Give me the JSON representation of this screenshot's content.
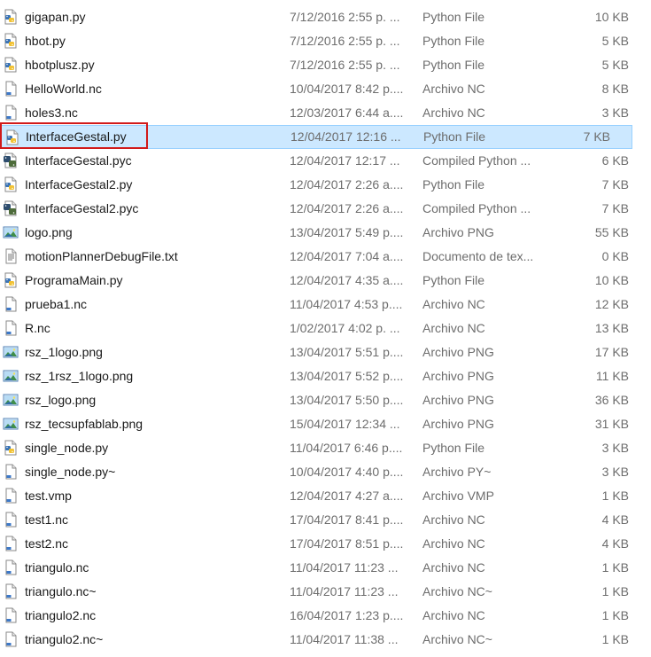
{
  "files": [
    {
      "name": "gigapan.py",
      "date": "7/12/2016 2:55 p. ...",
      "type": "Python File",
      "size": "10 KB",
      "icon": "python-file-icon"
    },
    {
      "name": "hbot.py",
      "date": "7/12/2016 2:55 p. ...",
      "type": "Python File",
      "size": "5 KB",
      "icon": "python-file-icon"
    },
    {
      "name": "hbotplusz.py",
      "date": "7/12/2016 2:55 p. ...",
      "type": "Python File",
      "size": "5 KB",
      "icon": "python-file-icon"
    },
    {
      "name": "HelloWorld.nc",
      "date": "10/04/2017 8:42 p....",
      "type": "Archivo NC",
      "size": "8 KB",
      "icon": "generic-file-icon"
    },
    {
      "name": "holes3.nc",
      "date": "12/03/2017 6:44 a....",
      "type": "Archivo NC",
      "size": "3 KB",
      "icon": "generic-file-icon"
    },
    {
      "name": "InterfaceGestal.py",
      "date": "12/04/2017 12:16 ...",
      "type": "Python File",
      "size": "7 KB",
      "icon": "python-file-icon",
      "selected": true
    },
    {
      "name": "InterfaceGestal.pyc",
      "date": "12/04/2017 12:17 ...",
      "type": "Compiled Python ...",
      "size": "6 KB",
      "icon": "compiled-python-icon"
    },
    {
      "name": "InterfaceGestal2.py",
      "date": "12/04/2017 2:26 a....",
      "type": "Python File",
      "size": "7 KB",
      "icon": "python-file-icon"
    },
    {
      "name": "InterfaceGestal2.pyc",
      "date": "12/04/2017 2:26 a....",
      "type": "Compiled Python ...",
      "size": "7 KB",
      "icon": "compiled-python-icon"
    },
    {
      "name": "logo.png",
      "date": "13/04/2017 5:49 p....",
      "type": "Archivo PNG",
      "size": "55 KB",
      "icon": "image-file-icon"
    },
    {
      "name": "motionPlannerDebugFile.txt",
      "date": "12/04/2017 7:04 a....",
      "type": "Documento de tex...",
      "size": "0 KB",
      "icon": "text-file-icon"
    },
    {
      "name": "ProgramaMain.py",
      "date": "12/04/2017 4:35 a....",
      "type": "Python File",
      "size": "10 KB",
      "icon": "python-file-icon"
    },
    {
      "name": "prueba1.nc",
      "date": "11/04/2017 4:53 p....",
      "type": "Archivo NC",
      "size": "12 KB",
      "icon": "generic-file-icon"
    },
    {
      "name": "R.nc",
      "date": "1/02/2017 4:02 p. ...",
      "type": "Archivo NC",
      "size": "13 KB",
      "icon": "generic-file-icon"
    },
    {
      "name": "rsz_1logo.png",
      "date": "13/04/2017 5:51 p....",
      "type": "Archivo PNG",
      "size": "17 KB",
      "icon": "image-file-icon"
    },
    {
      "name": "rsz_1rsz_1logo.png",
      "date": "13/04/2017 5:52 p....",
      "type": "Archivo PNG",
      "size": "11 KB",
      "icon": "image-file-icon"
    },
    {
      "name": "rsz_logo.png",
      "date": "13/04/2017 5:50 p....",
      "type": "Archivo PNG",
      "size": "36 KB",
      "icon": "image-file-icon"
    },
    {
      "name": "rsz_tecsupfablab.png",
      "date": "15/04/2017 12:34 ...",
      "type": "Archivo PNG",
      "size": "31 KB",
      "icon": "image-file-icon"
    },
    {
      "name": "single_node.py",
      "date": "11/04/2017 6:46 p....",
      "type": "Python File",
      "size": "3 KB",
      "icon": "python-file-icon"
    },
    {
      "name": "single_node.py~",
      "date": "10/04/2017 4:40 p....",
      "type": "Archivo PY~",
      "size": "3 KB",
      "icon": "generic-file-icon"
    },
    {
      "name": "test.vmp",
      "date": "12/04/2017 4:27 a....",
      "type": "Archivo VMP",
      "size": "1 KB",
      "icon": "generic-file-icon"
    },
    {
      "name": "test1.nc",
      "date": "17/04/2017 8:41 p....",
      "type": "Archivo NC",
      "size": "4 KB",
      "icon": "generic-file-icon"
    },
    {
      "name": "test2.nc",
      "date": "17/04/2017 8:51 p....",
      "type": "Archivo NC",
      "size": "4 KB",
      "icon": "generic-file-icon"
    },
    {
      "name": "triangulo.nc",
      "date": "11/04/2017 11:23 ...",
      "type": "Archivo NC",
      "size": "1 KB",
      "icon": "generic-file-icon"
    },
    {
      "name": "triangulo.nc~",
      "date": "11/04/2017 11:23 ...",
      "type": "Archivo NC~",
      "size": "1 KB",
      "icon": "generic-file-icon"
    },
    {
      "name": "triangulo2.nc",
      "date": "16/04/2017 1:23 p....",
      "type": "Archivo NC",
      "size": "1 KB",
      "icon": "generic-file-icon"
    },
    {
      "name": "triangulo2.nc~",
      "date": "11/04/2017 11:38 ...",
      "type": "Archivo NC~",
      "size": "1 KB",
      "icon": "generic-file-icon"
    }
  ],
  "colors": {
    "selection_bg": "#cce8ff",
    "selection_border": "#99d1ff",
    "highlight_box": "#d11a1a",
    "secondary_text": "#6d6d6d"
  }
}
